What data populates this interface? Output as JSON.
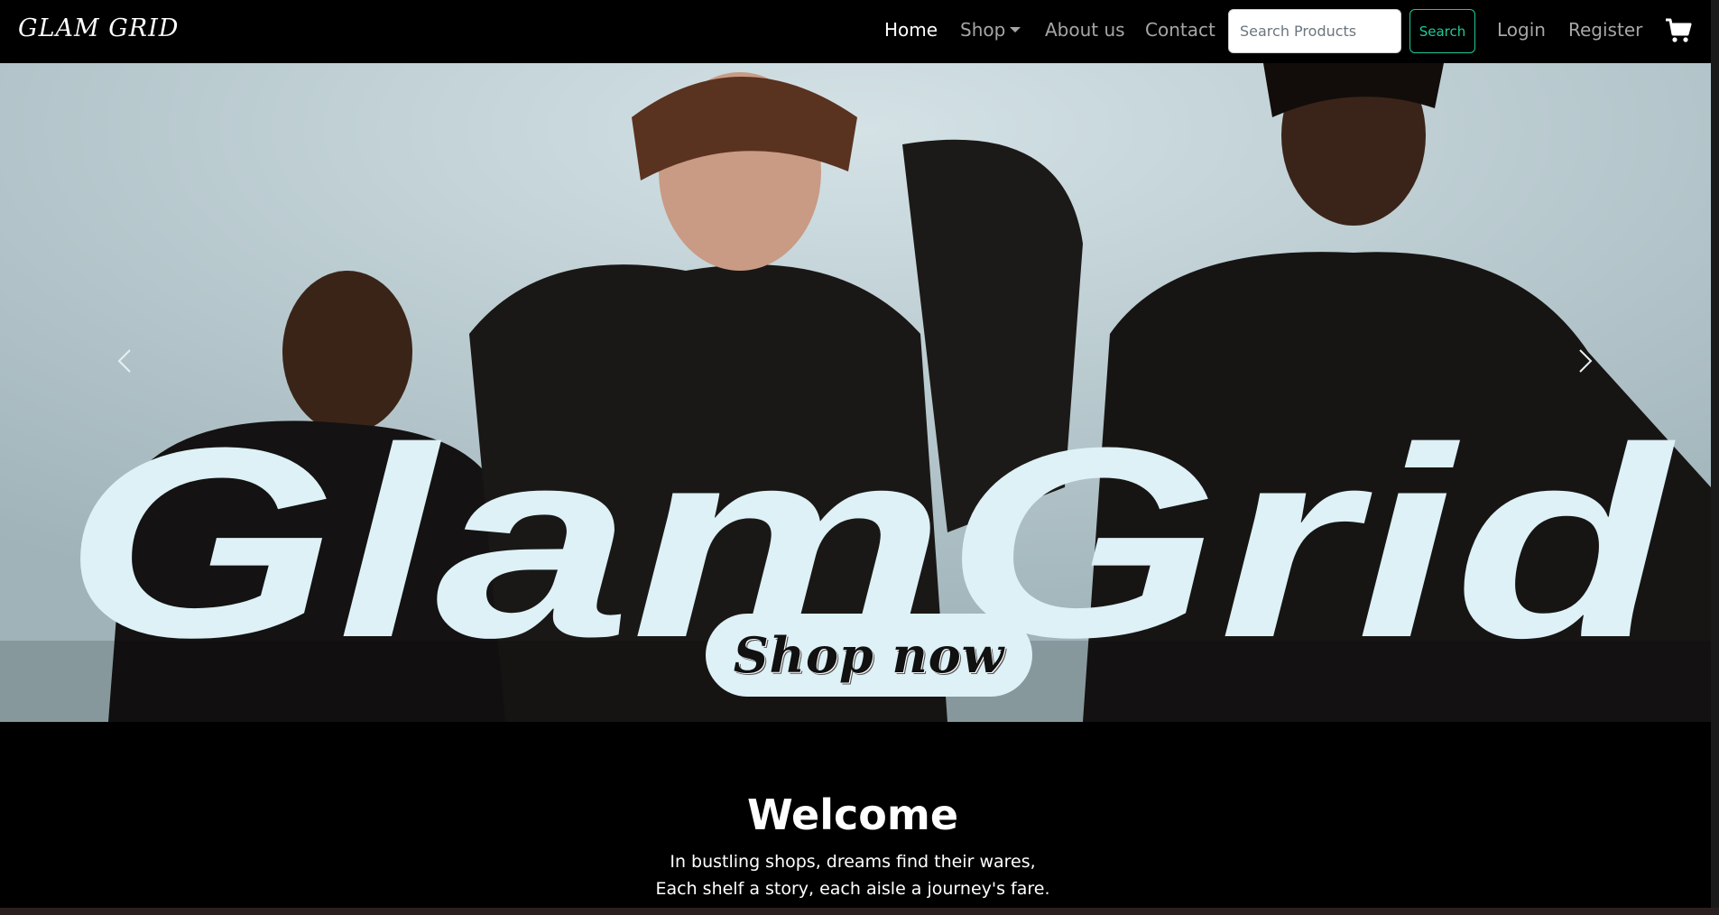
{
  "brand": {
    "name": "GLAM GRID"
  },
  "nav": {
    "home": "Home",
    "shop": "Shop",
    "about": "About us",
    "contact": "Contact",
    "login": "Login",
    "register": "Register"
  },
  "search": {
    "placeholder": "Search Products",
    "button_label": "Search"
  },
  "cart": {
    "icon": "cart-icon"
  },
  "hero": {
    "title": "GlamGrid",
    "cta_label": "Shop now",
    "prev_icon": "chevron-left-icon",
    "next_icon": "chevron-right-icon"
  },
  "welcome": {
    "title": "Welcome",
    "line1": "In bustling shops, dreams find their wares,",
    "line2": "Each shelf a story, each aisle a journey's fare."
  },
  "colors": {
    "background": "#000000",
    "accent": "#20c997",
    "hero_text": "#ddf1f6",
    "nav_muted": "#a6a6a6"
  }
}
